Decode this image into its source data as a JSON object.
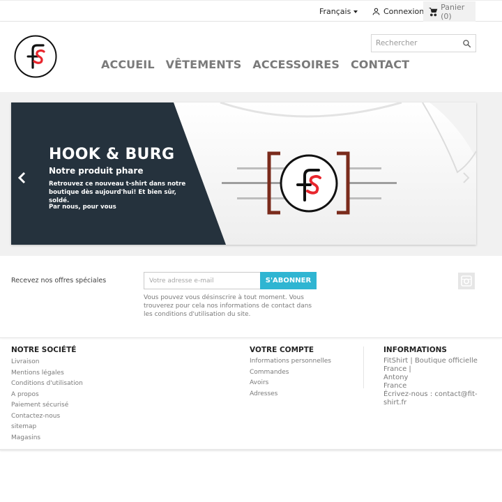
{
  "topbar": {
    "language": "Français",
    "login": "Connexion",
    "cart": "Panier (0)"
  },
  "header": {
    "nav": [
      "ACCUEIL",
      "VÊTEMENTS",
      "ACCESSOIRES",
      "CONTACT"
    ],
    "search_placeholder": "Rechercher"
  },
  "slider": {
    "title": "HOOK & BURG",
    "subtitle": "Notre produit phare",
    "description": "Retrouvez ce nouveau t-shirt dans notre boutique dès aujourd'hui! Et bien sûr, soldé.",
    "tagline": "Par nous, pour vous"
  },
  "newsletter": {
    "label": "Recevez nos offres spéciales",
    "placeholder": "Votre adresse e-mail",
    "button": "S'ABONNER",
    "note": "Vous pouvez vous désinscrire à tout moment. Vous trouverez pour cela nos informations de contact dans les conditions d'utilisation du site."
  },
  "footer": {
    "company": {
      "title": "NOTRE SOCIÉTÉ",
      "links": [
        "Livraison",
        "Mentions légales",
        "Conditions d'utilisation",
        "A propos",
        "Paiement sécurisé",
        "Contactez-nous",
        "sitemap",
        "Magasins"
      ]
    },
    "account": {
      "title": "VOTRE COMPTE",
      "links": [
        "Informations personnelles",
        "Commandes",
        "Avoirs",
        "Adresses"
      ]
    },
    "info": {
      "title": "INFORMATIONS",
      "lines": [
        "FitShirt | Boutique officielle France |",
        "Antony",
        "France",
        "Écrivez-nous : contact@fit-shirt.fr"
      ]
    }
  },
  "colors": {
    "accent": "#2fb5d2",
    "slide_panel": "#25323d",
    "logo_red": "#e8262d",
    "bracket": "#7a2b1c"
  }
}
